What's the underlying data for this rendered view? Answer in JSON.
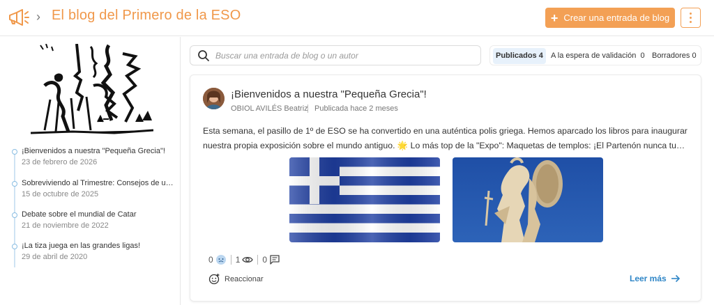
{
  "header": {
    "title": "El blog del Primero de la ESO",
    "create_label": "Crear una entrada de blog",
    "brand_color": "#f0984a",
    "icons": [
      "megaphone-icon",
      "chevron-right-icon",
      "plus-icon",
      "more-vertical-icon"
    ]
  },
  "sidebar": {
    "entries": [
      {
        "title": "¡Bienvenidos a nuestra \"Pequeña Grecia\"!",
        "date": "23 de febrero de 2026"
      },
      {
        "title": "Sobreviviendo al Trimestre: Consejos de un (…",
        "date": "15 de octubre de 2025"
      },
      {
        "title": "Debate sobre el mundial de Catar",
        "date": "21 de noviembre de 2022"
      },
      {
        "title": "¡La tiza juega en las grandes ligas!",
        "date": "29 de abril de 2020"
      }
    ]
  },
  "search": {
    "placeholder": "Buscar una entrada de blog o un autor"
  },
  "tabs": [
    {
      "label": "Publicados",
      "count": "4",
      "active": true
    },
    {
      "label": "A la espera de validación",
      "count": "0",
      "active": false
    },
    {
      "label": "Borradores",
      "count": "0",
      "active": false
    }
  ],
  "post": {
    "title": "¡Bienvenidos a nuestra \"Pequeña Grecia\"!",
    "author": "OBIOL AVILÉS Beatriz",
    "date": "Publicada hace 2 meses",
    "excerpt_line1": "Esta semana, el pasillo de 1º de ESO se ha convertido en una auténtica polis griega. Hemos aparcado los libros para inaugurar",
    "excerpt_line2": "nuestra propia exposición sobre el mundo antiguo. 🌟 Lo más top de la \"Expo\": Maquetas de templos: ¡El Partenón nunca tuvo...",
    "reactions_count": "0",
    "views_count": "1",
    "comments_count": "0",
    "react_label": "Reaccionar",
    "read_more_label": "Leer más",
    "link_color": "#2f86c7"
  }
}
